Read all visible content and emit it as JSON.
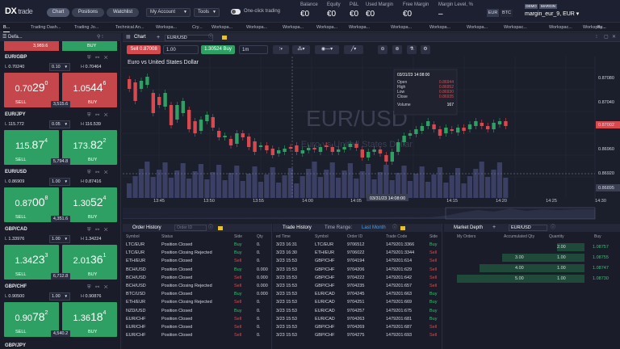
{
  "topbar": {
    "logo_mark": "DX",
    "logo_text": "trade",
    "tabs": [
      {
        "label": "Chart",
        "active": true
      },
      {
        "label": "Positions",
        "active": false
      },
      {
        "label": "Watchlist",
        "active": false
      }
    ],
    "my_account": "My Account",
    "tools": "Tools",
    "one_click": "One-click trading",
    "stats": [
      {
        "label": "Balance",
        "value": "€0"
      },
      {
        "label": "Equity",
        "value": "€0"
      },
      {
        "label": "P&L",
        "value": "€0"
      },
      {
        "label": "Used Margin",
        "value": "€0"
      },
      {
        "label": "Free Margin",
        "value": "€0"
      },
      {
        "label": "Margin Level, %",
        "value": "–"
      }
    ],
    "currencies": [
      "EUR",
      "BTC"
    ],
    "badge_demo": "DEMO",
    "badge_margin": "MARGIN",
    "account": "margin_eur_9, EUR ▾"
  },
  "workspace_tabs": [
    "B...",
    "Trading Dash...",
    "Trading Jo...",
    "Technical An...",
    "Workspa...",
    "Cry...",
    "Workspa...",
    "Workspa...",
    "Workspa...",
    "Workspa...",
    "Workspa...",
    "Workspa...",
    "Workspa...",
    "Workspa...",
    "Workspac...",
    "Workspac...",
    "Workspac...",
    "By..."
  ],
  "left": {
    "header": "Defa...",
    "first_partial": {
      "sell": "3,989.6",
      "buy": "BUY"
    },
    "instruments": [
      {
        "symbol": "EUR/GBP",
        "low": "0.70240",
        "high": "0.70464",
        "qty": "0.10",
        "sell_main": "0.70",
        "sell_big": "29",
        "sell_sup": "0",
        "buy_main": "1.05",
        "buy_big": "44",
        "buy_sup": "6",
        "spread": "3,515.6",
        "color": "red"
      },
      {
        "symbol": "EUR/JPY",
        "low": "115.772",
        "high": "116.539",
        "qty": "0.05",
        "sell_main": "115.",
        "sell_big": "87",
        "sell_sup": "4",
        "buy_main": "173.",
        "buy_big": "82",
        "buy_sup": "2",
        "spread": "5,794.8",
        "color": "green"
      },
      {
        "symbol": "EUR/USD",
        "low": "0.86909",
        "high": "0.87416",
        "qty": "1.00",
        "sell_main": "0.87",
        "sell_big": "00",
        "sell_sup": "8",
        "buy_main": "1.30",
        "buy_big": "52",
        "buy_sup": "4",
        "spread": "4,351.6",
        "color": "green"
      },
      {
        "symbol": "GBP/CAD",
        "low": "1.33976",
        "high": "1.34224",
        "qty": "1.00",
        "sell_main": "1.34",
        "sell_big": "23",
        "sell_sup": "3",
        "buy_main": "2.01",
        "buy_big": "36",
        "buy_sup": "1",
        "spread": "6,712.8",
        "color": "green"
      },
      {
        "symbol": "GBP/CHF",
        "low": "0.90500",
        "high": "0.90876",
        "qty": "1.00",
        "sell_main": "0.90",
        "sell_big": "78",
        "sell_sup": "2",
        "buy_main": "1.36",
        "buy_big": "18",
        "buy_sup": "4",
        "spread": "4,540.2",
        "color": "green"
      }
    ],
    "last_partial": "GBP/JPY",
    "low_prefix": "L",
    "high_prefix": "H",
    "sell_label": "SELL",
    "buy_label": "BUY"
  },
  "chart": {
    "panel_title": "Chart",
    "symbol_input": "EUR/USD",
    "sell_btn": "Sell 0.87008",
    "qty": "1.00",
    "buy_btn": "1.30524 Buy",
    "timeframe": "1m",
    "title": "Euro vs United States Dollar",
    "watermark_symbol": "EUR/USD",
    "watermark_name": "Euro vs United States Dollar",
    "price_labels": [
      "0.87080",
      "0.87040",
      "0.87002",
      "0.86960",
      "0.86920",
      "0.86895"
    ],
    "current_price": "0.87002",
    "last_price": "0.86895",
    "time_labels": [
      "13:45",
      "13:50",
      "13:55",
      "14:00",
      "14:05",
      "14:15",
      "14:20",
      "14:25",
      "14:30"
    ],
    "crosshair_time": "03/31/23 14:08:00",
    "tooltip": {
      "date": "03/31/23 14:08:00",
      "rows": [
        {
          "k": "Open",
          "v": "0.86944"
        },
        {
          "k": "High",
          "v": "0.86952"
        },
        {
          "k": "Low",
          "v": "0.86930"
        },
        {
          "k": "Close",
          "v": "0.86935"
        },
        {
          "k": "Volume",
          "v": "167"
        }
      ]
    },
    "colors": {
      "up": "#2ea063",
      "down": "#d9484c",
      "volume": "#3a3f63"
    }
  },
  "order_history": {
    "title": "Order History",
    "search_placeholder": "Order ID",
    "columns": [
      "Symbol",
      "Status",
      "Side",
      "Qty"
    ],
    "rows": [
      {
        "symbol": "LTC/EUR",
        "status": "Position Closed",
        "side": "Buy",
        "qty": "0."
      },
      {
        "symbol": "LTC/EUR",
        "status": "Position Closing Rejected",
        "side": "Buy",
        "qty": "0."
      },
      {
        "symbol": "ETH/EUR",
        "status": "Position Closed",
        "side": "Sell",
        "qty": "0."
      },
      {
        "symbol": "BCH/USD",
        "status": "Position Closed",
        "side": "Buy",
        "qty": "0.000"
      },
      {
        "symbol": "BCH/USD",
        "status": "Position Closed",
        "side": "Sell",
        "qty": "0.000"
      },
      {
        "symbol": "BCH/USD",
        "status": "Position Closing Rejected",
        "side": "Sell",
        "qty": "0.000"
      },
      {
        "symbol": "BTC/USD",
        "status": "Position Closed",
        "side": "Buy",
        "qty": "0.000"
      },
      {
        "symbol": "ETH/EUR",
        "status": "Position Closing Rejected",
        "side": "Sell",
        "qty": "0."
      },
      {
        "symbol": "NZD/USD",
        "status": "Position Closed",
        "side": "Buy",
        "qty": "0."
      },
      {
        "symbol": "EUR/CHF",
        "status": "Position Closed",
        "side": "Sell",
        "qty": "0."
      },
      {
        "symbol": "EUR/CHF",
        "status": "Position Closed",
        "side": "Sell",
        "qty": "0."
      },
      {
        "symbol": "EUR/CHF",
        "status": "Position Closed",
        "side": "Sell",
        "qty": "0."
      }
    ]
  },
  "trade_history": {
    "title": "Trade History",
    "range_label": "Time Range:",
    "range_value": "Last Month",
    "columns": [
      "ed Time",
      "Symbol",
      "Order ID",
      "Trade Code",
      "Side"
    ],
    "rows": [
      {
        "time": "3/23 16:31",
        "symbol": "LTC/EUR",
        "order": "9706512",
        "code": "1479201:3366",
        "side": "Buy"
      },
      {
        "time": "3/23 16:30",
        "symbol": "ETH/EUR",
        "order": "9706022",
        "code": "1479201:3344",
        "side": "Sell"
      },
      {
        "time": "3/23 15:53",
        "symbol": "GBP/CHF",
        "order": "9704194",
        "code": "1479201:614",
        "side": "Sell"
      },
      {
        "time": "3/23 15:53",
        "symbol": "GBP/CHF",
        "order": "9704206",
        "code": "1479201:629",
        "side": "Sell"
      },
      {
        "time": "3/23 15:53",
        "symbol": "GBP/CHF",
        "order": "9704222",
        "code": "1479201:642",
        "side": "Sell"
      },
      {
        "time": "3/23 15:53",
        "symbol": "GBP/CHF",
        "order": "9704235",
        "code": "1479201:657",
        "side": "Sell"
      },
      {
        "time": "3/23 15:53",
        "symbol": "EUR/CAD",
        "order": "9704245",
        "code": "1479201:663",
        "side": "Buy"
      },
      {
        "time": "3/23 15:53",
        "symbol": "EUR/CAD",
        "order": "9704251",
        "code": "1479201:669",
        "side": "Buy"
      },
      {
        "time": "3/23 15:53",
        "symbol": "EUR/CAD",
        "order": "9704257",
        "code": "1479201:675",
        "side": "Buy"
      },
      {
        "time": "3/23 15:53",
        "symbol": "EUR/CAD",
        "order": "9704263",
        "code": "1479201:681",
        "side": "Buy"
      },
      {
        "time": "3/23 15:53",
        "symbol": "GBP/CHF",
        "order": "9704269",
        "code": "1479201:687",
        "side": "Sell"
      },
      {
        "time": "3/23 15:53",
        "symbol": "GBP/CHF",
        "order": "9704275",
        "code": "1479201:693",
        "side": "Sell"
      }
    ]
  },
  "market_depth": {
    "title": "Market Depth",
    "symbol": "EUR/USD",
    "columns": [
      "My Orders",
      "Accumulated Qty",
      "Quantity",
      "Buy"
    ],
    "rows": [
      {
        "acc": "",
        "qty": "2.00",
        "price": "1.08757"
      },
      {
        "acc": "3.00",
        "qty": "1.00",
        "price": "1.08755"
      },
      {
        "acc": "4.00",
        "qty": "1.00",
        "price": "1.08747"
      },
      {
        "acc": "5.00",
        "qty": "1.00",
        "price": "1.08730"
      }
    ]
  }
}
